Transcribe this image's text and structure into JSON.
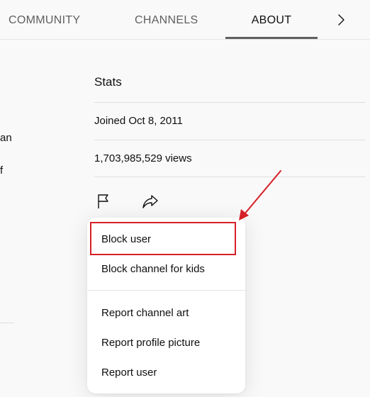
{
  "tabs": {
    "items": [
      {
        "label": "COMMUNITY",
        "selected": false
      },
      {
        "label": "CHANNELS",
        "selected": false
      },
      {
        "label": "ABOUT",
        "selected": true
      }
    ],
    "next_icon": "chevron-right-icon"
  },
  "left_column": {
    "fragment_1": "an",
    "fragment_2": "f"
  },
  "stats": {
    "heading": "Stats",
    "joined": "Joined Oct 8, 2011",
    "views": "1,703,985,529 views",
    "actions": [
      {
        "icon": "flag-icon"
      },
      {
        "icon": "share-icon"
      }
    ]
  },
  "menu": {
    "items": [
      {
        "label": "Block user",
        "highlighted": true
      },
      {
        "label": "Block channel for kids"
      },
      {
        "label": "Report channel art"
      },
      {
        "label": "Report profile picture"
      },
      {
        "label": "Report user"
      }
    ]
  },
  "colors": {
    "background": "#f9f9f9",
    "menu_background": "#ffffff",
    "annotation_red": "#d61f26",
    "tab_underline": "#606060",
    "text": "#0f0f0f",
    "muted_text": "#606060"
  }
}
